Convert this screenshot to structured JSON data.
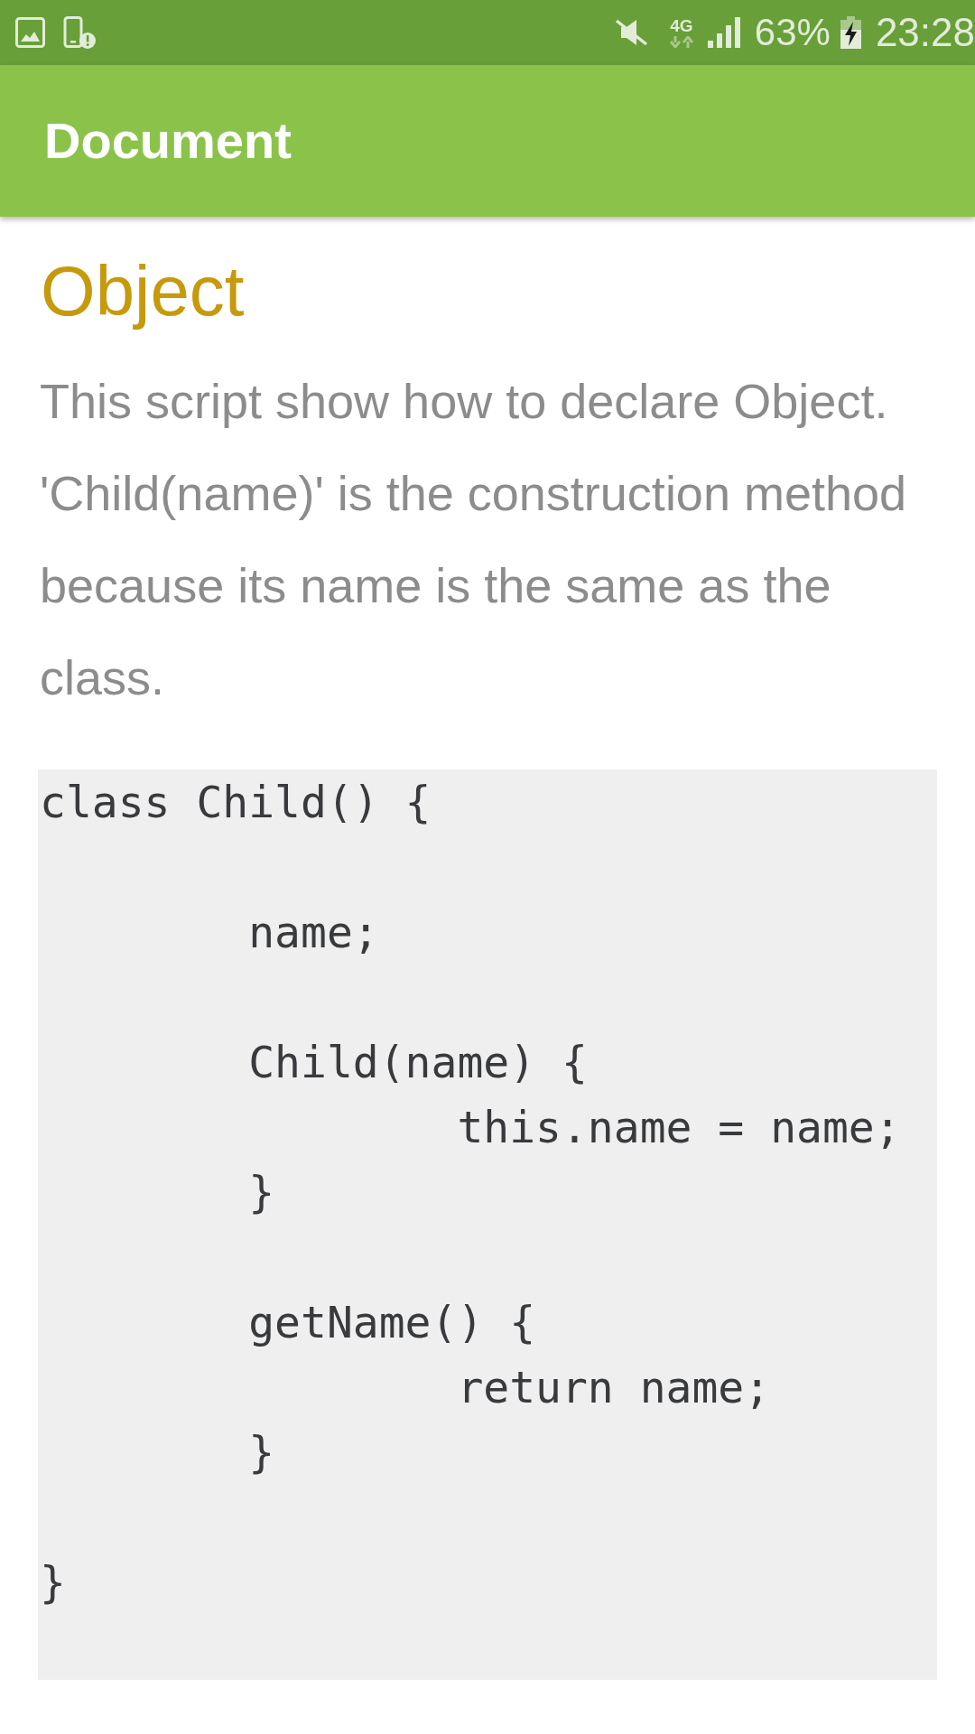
{
  "status_bar": {
    "network_type": "4G",
    "battery": "63%",
    "time": "23:28"
  },
  "app_bar": {
    "title": "Document"
  },
  "content": {
    "heading": "Object",
    "description": "This script show how to declare Object. 'Child(name)' is the construction method because its name is the same as the class.",
    "code": "class Child() {\n\n\tname;\n\n\tChild(name) {\n\t\tthis.name = name;\n\t}\n\n\tgetName() {\n\t\treturn name;\n\t}\n\n}"
  }
}
